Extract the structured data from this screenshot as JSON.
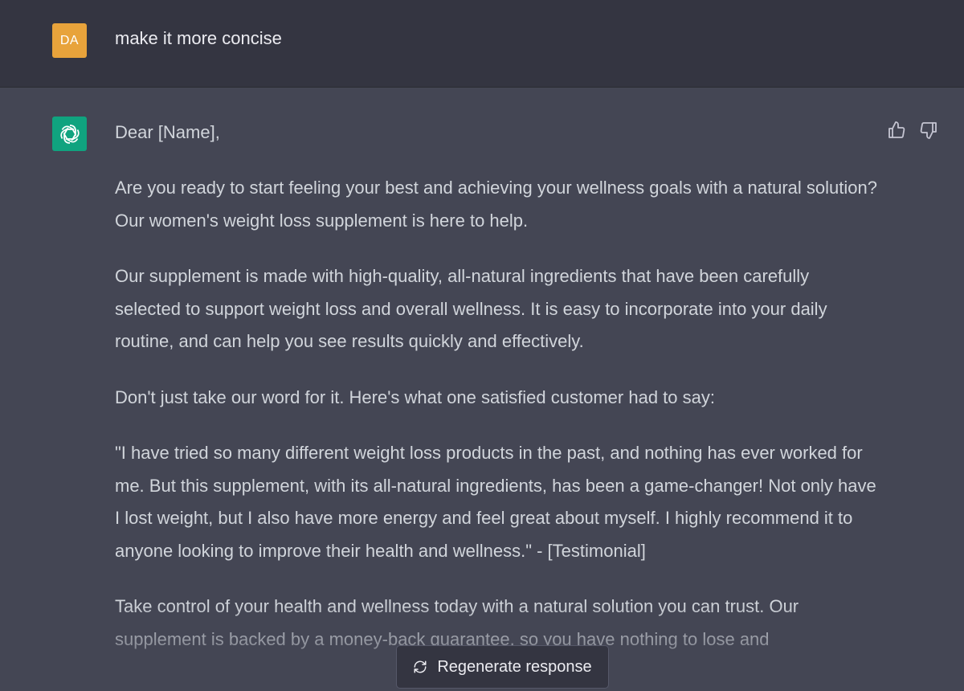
{
  "user_message": {
    "avatar_initials": "DA",
    "text": "make it more concise"
  },
  "assistant_message": {
    "paragraphs": [
      "Dear [Name],",
      "Are you ready to start feeling your best and achieving your wellness goals with a natural solution? Our women's weight loss supplement is here to help.",
      "Our supplement is made with high-quality, all-natural ingredients that have been carefully selected to support weight loss and overall wellness. It is easy to incorporate into your daily routine, and can help you see results quickly and effectively.",
      "Don't just take our word for it. Here's what one satisfied customer had to say:",
      "\"I have tried so many different weight loss products in the past, and nothing has ever worked for me. But this supplement, with its all-natural ingredients, has been a game-changer! Not only have I lost weight, but I also have more energy and feel great about myself. I highly recommend it to anyone looking to improve their health and wellness.\" - [Testimonial]",
      "Take control of your health and wellness today with a natural solution you can trust. Our supplement is backed by a money-back guarantee, so you have nothing to lose and"
    ]
  },
  "actions": {
    "regenerate_label": "Regenerate response"
  },
  "icons": {
    "user_avatar_color": "#e8a33b",
    "bot_avatar_color": "#10a37f",
    "bot_icon": "openai-logo-icon",
    "thumbs_up": "thumbs-up-icon",
    "thumbs_down": "thumbs-down-icon",
    "regenerate": "refresh-icon"
  }
}
